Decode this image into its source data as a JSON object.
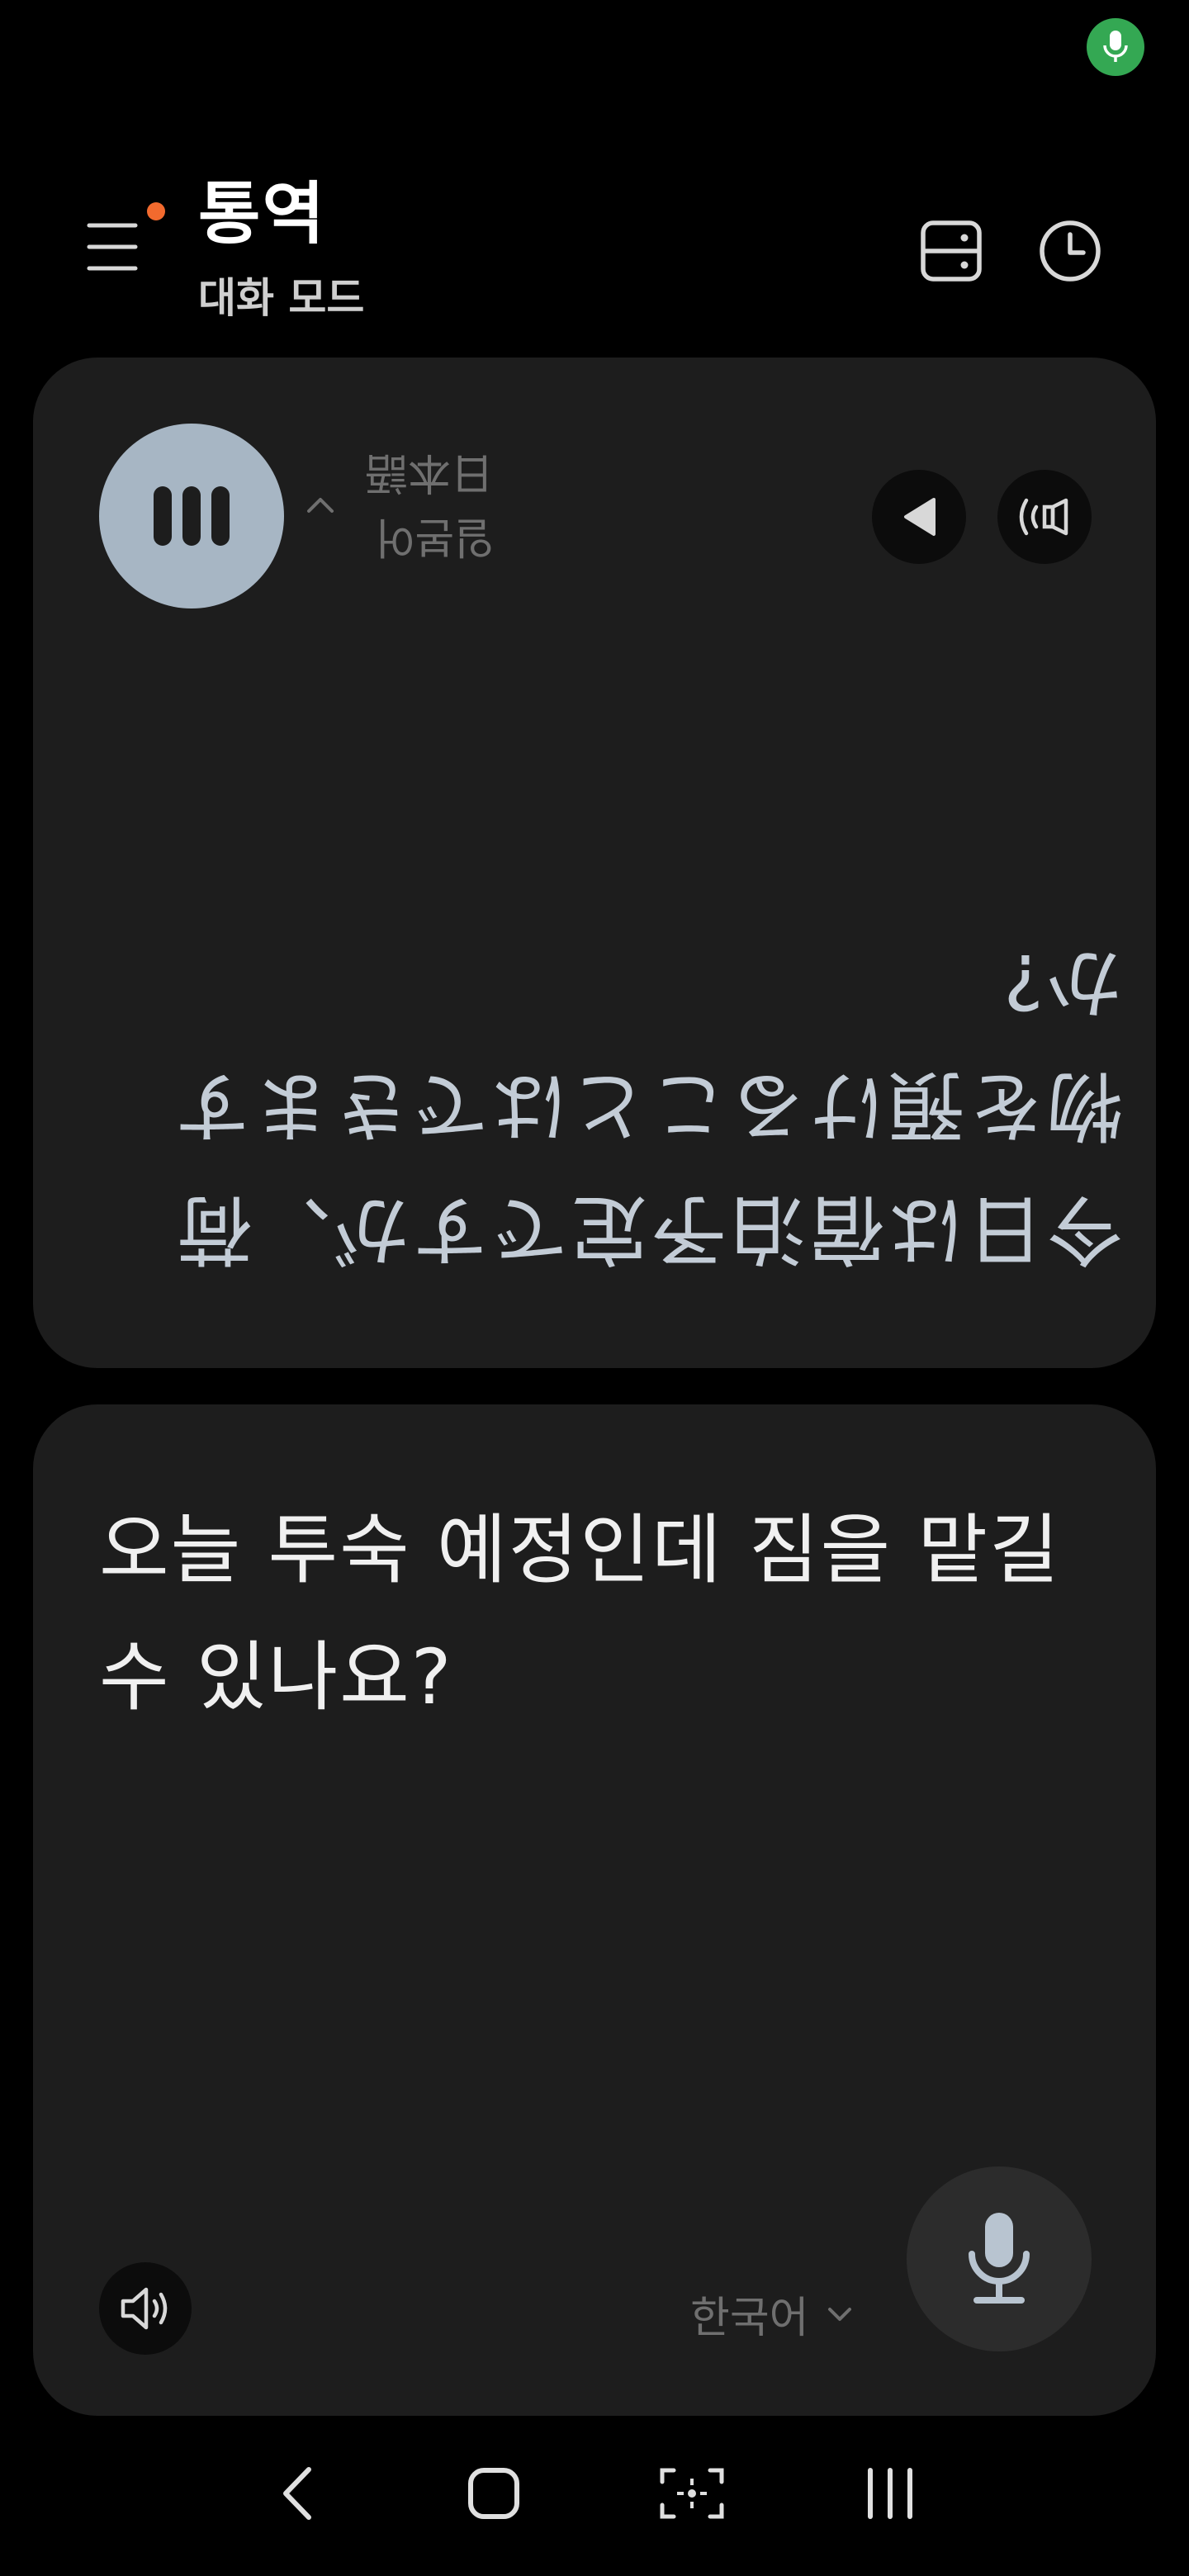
{
  "status_bar": {
    "mic_indicator_icon": "mic-icon",
    "indicator_color": "#34a853"
  },
  "header": {
    "title": "통역",
    "subtitle": "대화 모드",
    "menu_icon": "hamburger-menu-icon",
    "notification_dot_color": "#f26a2e",
    "layout_toggle_icon": "split-layout-icon",
    "history_icon": "clock-history-icon"
  },
  "top_panel": {
    "listening_icon": "pause-bars-icon",
    "language_current": "日本語",
    "language_other": "일본어",
    "expand_icon": "chevron-up-icon",
    "prev_icon": "triangle-left-icon",
    "voice_icon": "voice-output-icon",
    "translated_text": "今日は宿泊予定ですが、荷物を預けることはできますか?"
  },
  "bottom_panel": {
    "source_text": "오늘 투숙 예정인데 짐을 맡길 수 있나요?",
    "speaker_icon": "speaker-icon",
    "language_label": "한국어",
    "language_chevron_icon": "chevron-down-icon",
    "mic_icon": "mic-icon"
  },
  "nav_bar": {
    "back_icon": "back-chevron-icon",
    "home_icon": "home-square-icon",
    "capture_icon": "screen-capture-icon",
    "recents_icon": "recents-bars-icon"
  },
  "colors": {
    "background": "#000000",
    "panel": "#1d1d1d",
    "accent_blue_grey": "#a7b6c4",
    "translated_text": "#c3ccd6",
    "muted_text": "#6f6f6f"
  }
}
